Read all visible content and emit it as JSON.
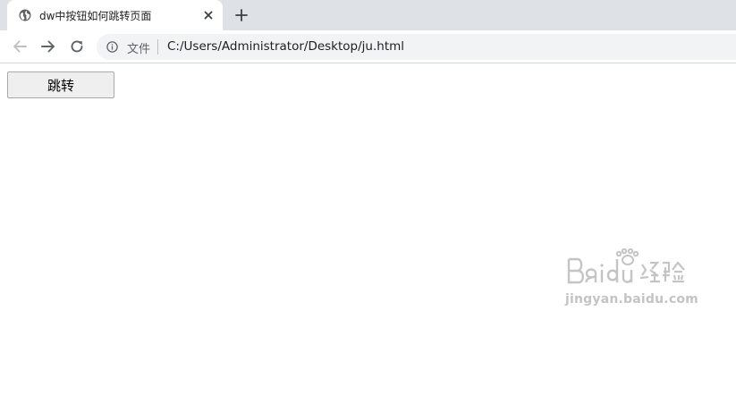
{
  "browser": {
    "tab": {
      "title": "dw中按钮如何跳转页面",
      "favicon": "globe-icon",
      "close_icon": "close-icon"
    },
    "new_tab_icon": "plus-icon",
    "nav": {
      "back_icon": "arrow-left-icon",
      "forward_icon": "arrow-right-icon",
      "reload_icon": "reload-icon"
    },
    "omnibox": {
      "info_icon": "info-icon",
      "scheme_label": "文件",
      "url": "C:/Users/Administrator/Desktop/ju.html"
    }
  },
  "page": {
    "button_label": "跳转"
  },
  "watermark": {
    "logo_text": "Baidu经验",
    "url_text": "jingyan.baidu.com"
  },
  "colors": {
    "tabstrip_bg": "#dee1e6",
    "omnibox_bg": "#f1f3f4",
    "button_bg": "#efefef",
    "watermark": "#c4c4c4"
  }
}
